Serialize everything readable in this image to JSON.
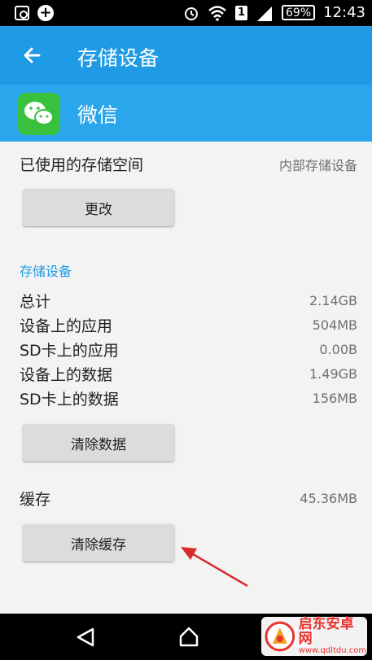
{
  "status_bar": {
    "battery": "69%",
    "sim": "1",
    "time": "12:43"
  },
  "app_bar": {
    "title": "存储设备"
  },
  "app_header": {
    "app_name": "微信"
  },
  "storage_used": {
    "label": "已使用的存储空间",
    "value": "内部存储设备",
    "change_button": "更改"
  },
  "storage_section": {
    "title": "存储设备",
    "rows": [
      {
        "label": "总计",
        "value": "2.14GB"
      },
      {
        "label": "设备上的应用",
        "value": "504MB"
      },
      {
        "label": "SD卡上的应用",
        "value": "0.00B"
      },
      {
        "label": "设备上的数据",
        "value": "1.49GB"
      },
      {
        "label": "SD卡上的数据",
        "value": "156MB"
      }
    ],
    "clear_data_button": "清除数据"
  },
  "cache": {
    "label": "缓存",
    "value": "45.36MB",
    "clear_cache_button": "清除缓存"
  },
  "watermark": {
    "name": "启东安卓网",
    "url": "www.qdltdu.com"
  },
  "colors": {
    "app_bar": "#1f9be6",
    "app_header": "#2aa7ec",
    "accent_text": "#1f9be6",
    "annotation_arrow": "#d92b2b",
    "wechat_green": "#39c13d"
  }
}
